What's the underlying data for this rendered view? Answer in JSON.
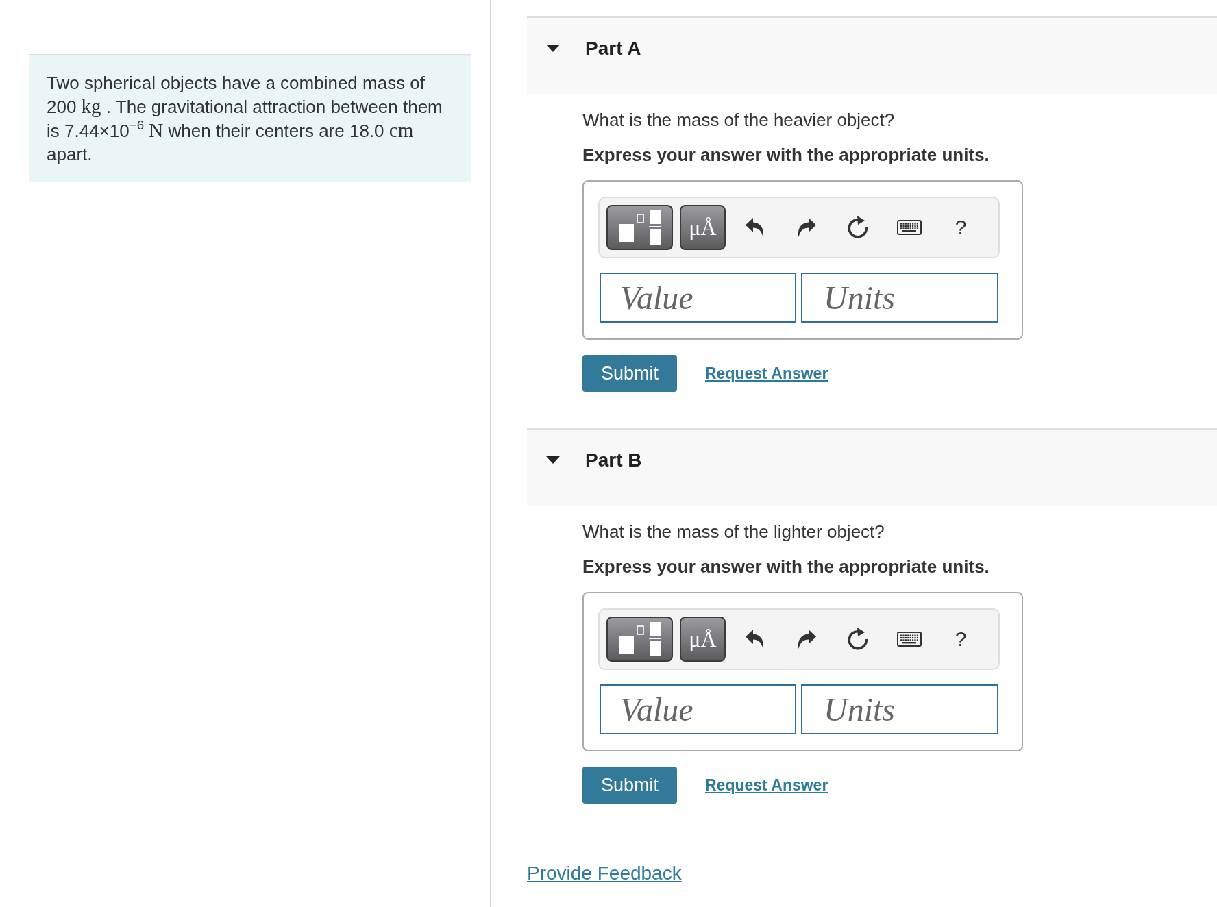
{
  "problem": {
    "segments": [
      {
        "kind": "text",
        "text": "Two spherical objects have a combined mass of 200 "
      },
      {
        "kind": "math",
        "text": "kg"
      },
      {
        "kind": "text",
        "text": " . The gravitational attraction between them is 7.44×10$^{−6}$ "
      },
      {
        "kind": "math",
        "text": "N"
      },
      {
        "kind": "text",
        "text": " when their centers are 18.0 "
      },
      {
        "kind": "math",
        "text": "cm"
      },
      {
        "kind": "text",
        "text": " apart."
      }
    ]
  },
  "parts": [
    {
      "title": "Part A",
      "expanded": true,
      "question": "What is the mass of the heavier object?",
      "instruction": "Express your answer with the appropriate units.",
      "toolbar": [
        {
          "kind": "template"
        },
        {
          "kind": "units",
          "label": "μÅ"
        },
        {
          "kind": "undo"
        },
        {
          "kind": "redo"
        },
        {
          "kind": "reset"
        },
        {
          "kind": "keyboard"
        },
        {
          "kind": "help",
          "label": "?"
        }
      ],
      "value_field": {
        "placeholder": "Value"
      },
      "units_field": {
        "placeholder": "Units"
      },
      "submit": "Submit",
      "request_link": "Request Answer"
    },
    {
      "title": "Part B",
      "expanded": true,
      "question": "What is the mass of the lighter object?",
      "instruction": "Express your answer with the appropriate units.",
      "toolbar": [
        {
          "kind": "template"
        },
        {
          "kind": "units",
          "label": "μÅ"
        },
        {
          "kind": "undo"
        },
        {
          "kind": "redo"
        },
        {
          "kind": "reset"
        },
        {
          "kind": "keyboard"
        },
        {
          "kind": "help",
          "label": "?"
        }
      ],
      "value_field": {
        "placeholder": "Value"
      },
      "units_field": {
        "placeholder": "Units"
      },
      "submit": "Submit",
      "request_link": "Request Answer"
    }
  ],
  "feedback_link": "Provide Feedback"
}
